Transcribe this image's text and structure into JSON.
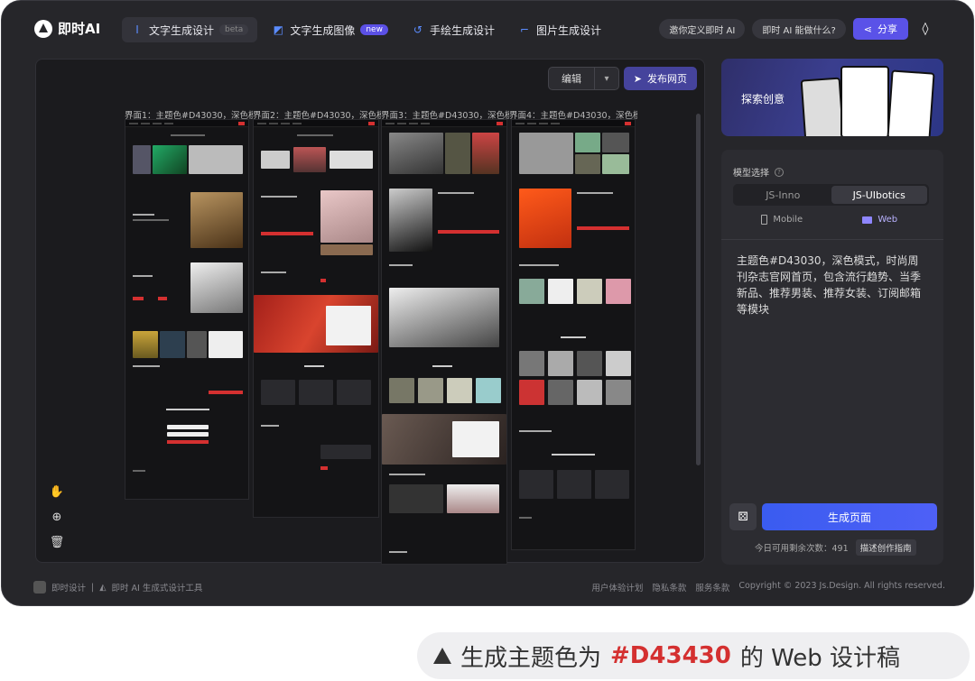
{
  "app": {
    "title": "即时AI"
  },
  "tabs": [
    {
      "label": "文字生成设计",
      "tag": "beta",
      "icon": "text-design-icon"
    },
    {
      "label": "文字生成图像",
      "tag": "new",
      "icon": "text-image-icon"
    },
    {
      "label": "手绘生成设计",
      "icon": "sketch-icon"
    },
    {
      "label": "图片生成设计",
      "icon": "image-design-icon"
    }
  ],
  "header": {
    "customize": "邀你定义即时 AI",
    "whatcan": "即时 AI 能做什么?",
    "share": "分享"
  },
  "canvas": {
    "edit": "编辑",
    "publish": "发布网页",
    "frames": [
      "界面1：主题色#D43030，深色模...",
      "界面2：主题色#D43030，深色模...",
      "界面3：主题色#D43030，深色模...",
      "界面4：主题色#D43030，深色模..."
    ]
  },
  "banner": {
    "text": "探索创意"
  },
  "panel": {
    "model_label": "模型选择",
    "models": [
      "JS-Inno",
      "JS-UIbotics"
    ],
    "active_model": "JS-UIbotics",
    "devices": [
      "Mobile",
      "Web"
    ],
    "active_device": "Web",
    "prompt": "主题色#D43030，深色模式，时尚周刊杂志官网首页，包含流行趋势、当季新品、推荐男装、推荐女装、订阅邮箱等模块",
    "generate": "生成页面",
    "quota": "今日可用剩余次数：491",
    "guide": "描述创作指南"
  },
  "footer": {
    "brand": "即时设计",
    "sep": "|",
    "tool": "即时 AI 生成式设计工具",
    "links": [
      "用户体验计划",
      "隐私条款",
      "服务条款"
    ],
    "copyright": "Copyright © 2023 Js.Design. All rights reserved."
  },
  "caption": {
    "pre": "生成主题色为",
    "color": "#D43430",
    "post": "的 Web 设计稿"
  },
  "colors": {
    "accent": "#5a52e8",
    "theme": "#d43030",
    "bg": "#26262a"
  }
}
